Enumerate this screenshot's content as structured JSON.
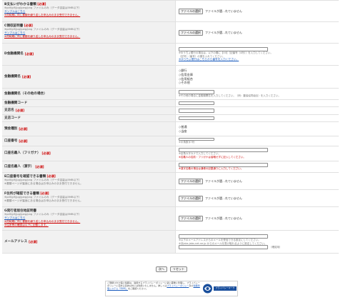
{
  "common": {
    "required": "[必須]",
    "file_button": "ファイルの選択",
    "no_file": "ファイルが選…れていません"
  },
  "rows": {
    "r1": {
      "label": "B支払いがわかる書類",
      "sub": "※pdf/gif/jpg/jpeg/png ファイルのみ（データ容量は5MB以下）",
      "link": "サンプルはこちら",
      "warn": "※同時期に同じ書類を繰り返しお申込みのまま受付できません。"
    },
    "r2": {
      "label": "C領収証明書",
      "sub": "※pdf/gif/jpg/jpeg/png ファイルのみ（データ容量は5MB以下）",
      "link": "サンプルはこちら",
      "warn": "※同時期に同じ書類を繰り返しお申込みのまま受付できません。"
    },
    "r3": {
      "label": "D金融機関名",
      "note1": "※ゆうちょ銀行の場合は、以下の欄に【00】［記番号（4桁）］を入力してください。",
      "note2": "（記号）（番号）の頭を入れてください。",
      "link": "※ゆうちょ銀行はこちらから番号を入力ください。"
    },
    "r4": {
      "label": "金融機関名",
      "options": [
        "◇銀行",
        "◇信用金庫",
        "◇信用組合",
        "◇その他"
      ]
    },
    "r5": {
      "label": "金融機関名（その他の場合）",
      "note": "※その他の場合に金融機関名を入力してください。（例：農協協同組合）を入力ください。"
    },
    "r6": {
      "label": "金融機関コード"
    },
    "r7": {
      "label": "支店名"
    },
    "r8": {
      "label": "支店コード"
    },
    "r9": {
      "label": "預金種別",
      "options": [
        "◇普通",
        "◇当座"
      ]
    },
    "r10": {
      "label": "口座番号",
      "note": "※半角数字7桁"
    },
    "r11": {
      "label": "口座名義人（フリガナ）",
      "note": "※全角カタカナで入力してください。",
      "rnote": "※名義人の名前・フリガナは省略せずに記入してください。"
    },
    "r12": {
      "label": "口座名義人（漢字）",
      "rnote": "※漢字名義の場合は通帳の記載通りに入力してください。"
    },
    "r13": {
      "label": "E口座番号を確認できる書類",
      "sub1": "※pdf/gif/jpg/jpeg/png ファイルのみ（データ容量は5MB以下）",
      "sub2": "※書類ページが裏面にある場合はお申込みのまま受付できません。"
    },
    "r14": {
      "label": "F住所が確認できる書類",
      "sub1": "※pdf/gif/jpg/jpeg/png ファイルのみ（データ容量は5MB以下）",
      "sub2": "※書類ページが裏面にある場合はお申込みのまま受付できません。"
    },
    "r15": {
      "label": "G発行者居住地証明書",
      "sub": "※pdf/gif/jpg/jpeg/png ファイルのみ（データ容量は5MB以下）",
      "link": "サンプルはこちら",
      "warn1": "※同時期に同じ書類を繰り返しお申込みのまま受付できません。",
      "warn2": "※住所等の確認は以下に記載します。"
    },
    "r16": {
      "label": "メールアドレス",
      "note1": "※以下のメールアドレスからのメールを受信できる設定にしてください。",
      "note2": "※@jabs.jabs.net.ne.jp からのメールを受け取れるように設定してください。",
      "confirm": "（確認用）"
    }
  },
  "buttons": {
    "next": "次へ",
    "reset": "リセット"
  },
  "footer": {
    "text": "ご登録された個人情報は、適用するプライバシーポリシーに従い厳重に管理し、プライバシーポリシーに定める目的以外には利用いたしません。詳しくは",
    "link1": "プライバシーポリシー",
    "mid": "及び",
    "link2": "情報管理システム「ISMS」",
    "tail": "をご確認ください。",
    "badge": "プライバシーマーク"
  }
}
